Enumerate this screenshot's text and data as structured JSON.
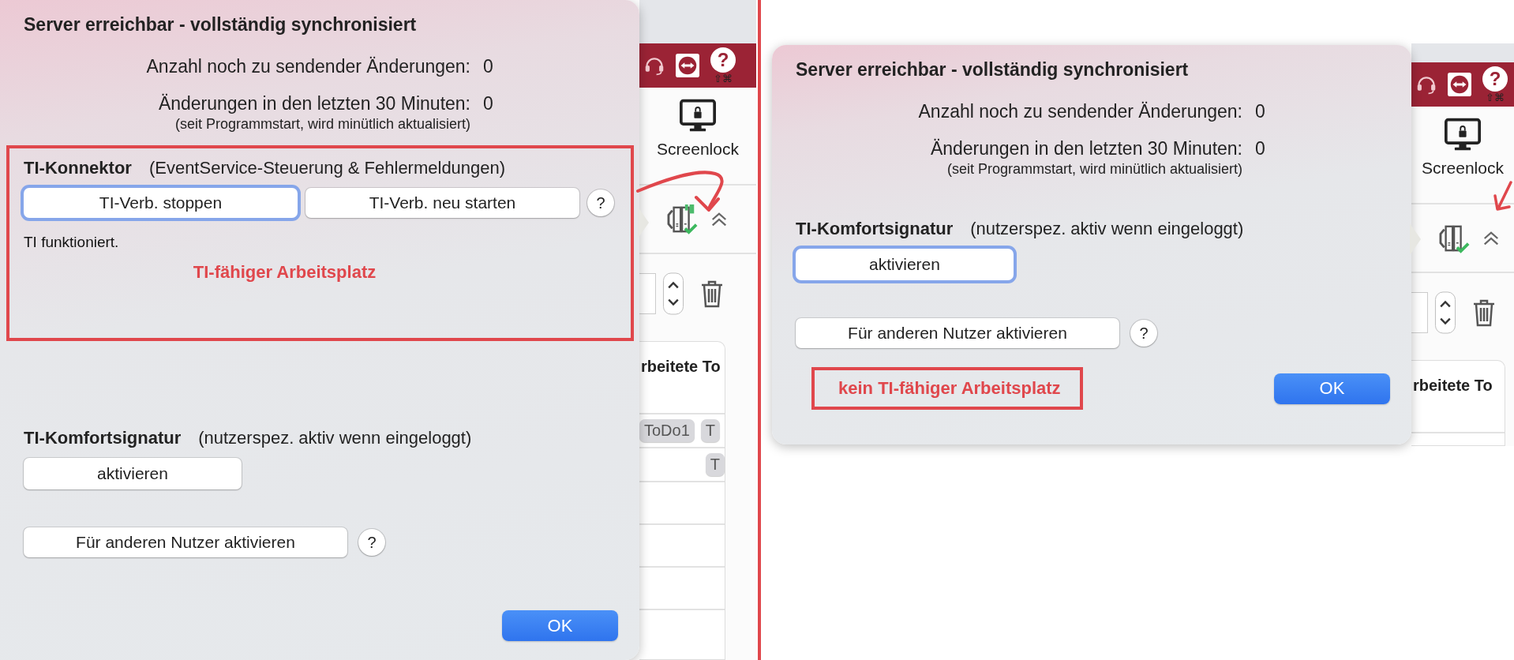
{
  "panels": [
    {
      "popover": {
        "title": "Server erreichbar - vollständig synchronisiert",
        "stats": [
          {
            "label": "Anzahl noch zu sendender Änderungen:",
            "value": "0"
          },
          {
            "label": "Änderungen in den letzten 30 Minuten:",
            "value": "0"
          }
        ],
        "stats_note": "(seit Programmstart, wird minütlich aktualisiert)",
        "sections": [
          {
            "kind": "connector",
            "highlighted": true,
            "heading": "TI-Konnektor",
            "subheading": "(EventService-Steuerung & Fehlermeldungen)",
            "buttons": [
              {
                "label": "TI-Verb. stoppen",
                "focused": true
              },
              {
                "label": "TI-Verb. neu starten",
                "focused": false
              }
            ],
            "help": "?",
            "status": "TI funktioniert.",
            "remark": "TI-fähiger Arbeitsplatz"
          },
          {
            "kind": "signature",
            "heading": "TI-Komfortsignatur",
            "subheading": "(nutzerspez. aktiv wenn eingeloggt)",
            "activate": {
              "label": "aktivieren",
              "focused": false
            },
            "other_user": "Für anderen Nutzer aktivieren",
            "help": "?"
          }
        ],
        "ok": "OK"
      },
      "app": {
        "toolbar_help": "?",
        "shortcut": "⇧⌘",
        "screenlock": "Screenlock",
        "flagged": true,
        "card_header": "rbeitete To",
        "tags": [
          "ToDo1",
          "T"
        ],
        "row_tags": [
          "T"
        ]
      }
    },
    {
      "popover": {
        "title": "Server erreichbar - vollständig synchronisiert",
        "stats": [
          {
            "label": "Anzahl noch zu sendender Änderungen:",
            "value": "0"
          },
          {
            "label": "Änderungen in den letzten 30 Minuten:",
            "value": "0"
          }
        ],
        "stats_note": "(seit Programmstart, wird minütlich aktualisiert)",
        "sections": [
          {
            "kind": "signature",
            "heading": "TI-Komfortsignatur",
            "subheading": "(nutzerspez. aktiv wenn eingeloggt)",
            "activate": {
              "label": "aktivieren",
              "focused": true
            },
            "other_user": "Für anderen Nutzer aktivieren",
            "help": "?"
          }
        ],
        "footer_remark": "kein TI-fähiger Arbeitsplatz",
        "ok": "OK"
      },
      "app": {
        "toolbar_help": "?",
        "shortcut": "⇧⌘",
        "screenlock": "Screenlock",
        "flagged": false,
        "card_header": "rbeitete To"
      }
    }
  ]
}
